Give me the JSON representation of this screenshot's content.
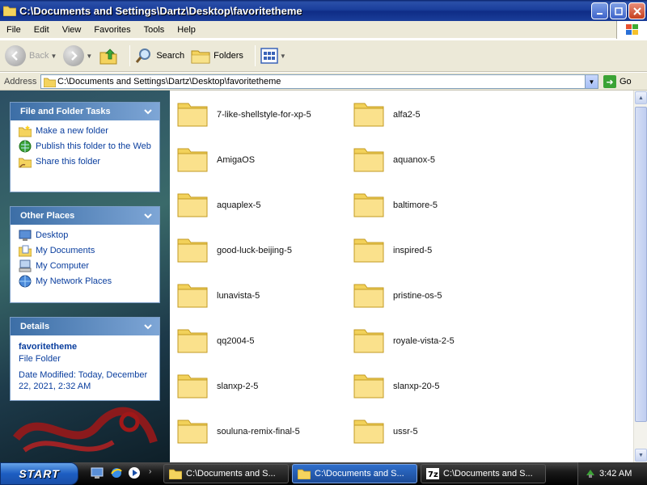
{
  "window": {
    "title": "C:\\Documents and Settings\\Dartz\\Desktop\\favoritetheme"
  },
  "menu": [
    "File",
    "Edit",
    "View",
    "Favorites",
    "Tools",
    "Help"
  ],
  "toolbar": {
    "back_label": "Back",
    "search_label": "Search",
    "folders_label": "Folders"
  },
  "address": {
    "label": "Address",
    "value": "C:\\Documents and Settings\\Dartz\\Desktop\\favoritetheme",
    "go_label": "Go"
  },
  "tasks_panel": {
    "title": "File and Folder Tasks",
    "items": [
      {
        "label": "Make a new folder",
        "icon": "new-folder-icon"
      },
      {
        "label": "Publish this folder to the Web",
        "icon": "publish-web-icon"
      },
      {
        "label": "Share this folder",
        "icon": "share-folder-icon"
      }
    ]
  },
  "places_panel": {
    "title": "Other Places",
    "items": [
      {
        "label": "Desktop",
        "icon": "desktop-icon"
      },
      {
        "label": "My Documents",
        "icon": "my-documents-icon"
      },
      {
        "label": "My Computer",
        "icon": "my-computer-icon"
      },
      {
        "label": "My Network Places",
        "icon": "network-places-icon"
      }
    ]
  },
  "details_panel": {
    "title": "Details",
    "name": "favoritetheme",
    "type": "File Folder",
    "modified_line1": "Date Modified: Today, December",
    "modified_line2": "22, 2021, 2:32 AM"
  },
  "folders": [
    "7-like-shellstyle-for-xp-5",
    "alfa2-5",
    "AmigaOS",
    "aquanox-5",
    "aquaplex-5",
    "baltimore-5",
    "good-luck-beijing-5",
    "inspired-5",
    "lunavista-5",
    "pristine-os-5",
    "qq2004-5",
    "royale-vista-2-5",
    "slanxp-2-5",
    "slanxp-20-5",
    "souluna-remix-final-5",
    "ussr-5"
  ],
  "taskbar": {
    "start_label": "START",
    "tasks": [
      {
        "label": "C:\\Documents and S...",
        "icon": "folder-icon",
        "active": false
      },
      {
        "label": "C:\\Documents and S...",
        "icon": "folder-icon",
        "active": true
      },
      {
        "label": "C:\\Documents and S...",
        "icon": "7zip-icon",
        "active": false
      }
    ],
    "clock": "3:42 AM"
  }
}
